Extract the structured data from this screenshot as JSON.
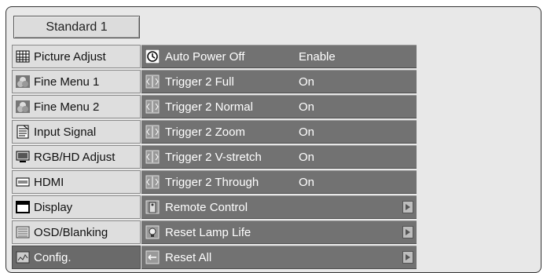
{
  "title_button": "Standard 1",
  "sidebar": {
    "items": [
      {
        "label": "Picture Adjust",
        "icon": "grid-icon",
        "selected": false
      },
      {
        "label": "Fine Menu 1",
        "icon": "color-circles-icon",
        "selected": false
      },
      {
        "label": "Fine Menu 2",
        "icon": "color-circles-icon",
        "selected": false
      },
      {
        "label": "Input Signal",
        "icon": "document-icon",
        "selected": false
      },
      {
        "label": "RGB/HD Adjust",
        "icon": "monitor-icon",
        "selected": false
      },
      {
        "label": "HDMI",
        "icon": "hdmi-icon",
        "selected": false
      },
      {
        "label": "Display",
        "icon": "display-icon",
        "selected": false
      },
      {
        "label": "OSD/Blanking",
        "icon": "osd-icon",
        "selected": false
      },
      {
        "label": "Config.",
        "icon": "config-icon",
        "selected": true
      }
    ]
  },
  "panel": {
    "rows": [
      {
        "label": "Auto Power Off",
        "value": "Enable",
        "icon": "clock-icon",
        "arrow": false
      },
      {
        "label": "Trigger 2 Full",
        "value": "On",
        "icon": "trigger-icon",
        "arrow": false
      },
      {
        "label": "Trigger 2 Normal",
        "value": "On",
        "icon": "trigger-icon",
        "arrow": false
      },
      {
        "label": "Trigger 2 Zoom",
        "value": "On",
        "icon": "trigger-icon",
        "arrow": false
      },
      {
        "label": "Trigger 2 V-stretch",
        "value": "On",
        "icon": "trigger-icon",
        "arrow": false
      },
      {
        "label": "Trigger 2 Through",
        "value": "On",
        "icon": "trigger-icon",
        "arrow": false
      },
      {
        "label": "Remote Control",
        "value": "",
        "icon": "remote-icon",
        "arrow": true
      },
      {
        "label": "Reset Lamp Life",
        "value": "",
        "icon": "lamp-icon",
        "arrow": true
      },
      {
        "label": "Reset All",
        "value": "",
        "icon": "reset-icon",
        "arrow": true
      }
    ]
  },
  "colors": {
    "background": "#e8e8e8",
    "row_dark": "#727272",
    "selected": "#6a6a6a",
    "text_light": "#ffffff"
  }
}
